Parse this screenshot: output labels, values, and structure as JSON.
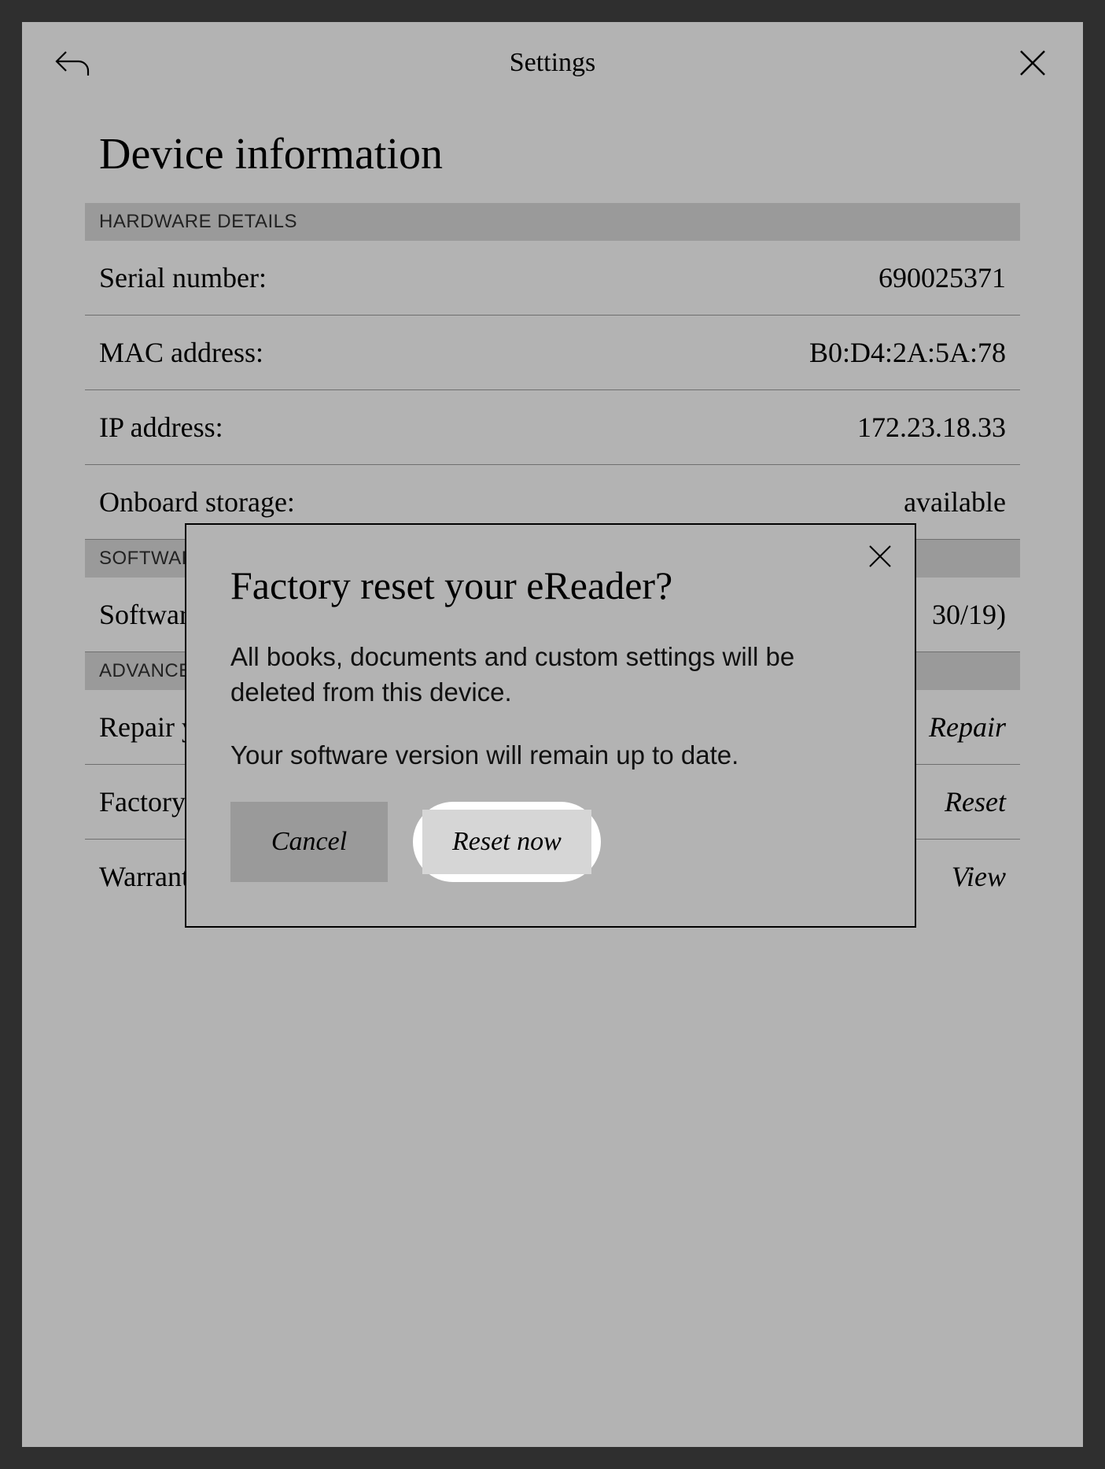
{
  "header": {
    "title": "Settings"
  },
  "page": {
    "title": "Device information"
  },
  "sections": {
    "hardware_header": "HARDWARE DETAILS",
    "software_header": "SOFTWARE DETAILS",
    "advanced_header": "ADVANCED"
  },
  "rows": {
    "serial_label": "Serial number:",
    "serial_value": "690025371",
    "mac_label": "MAC address:",
    "mac_value": "B0:D4:2A:5A:78",
    "ip_label": "IP address:",
    "ip_value": "172.23.18.33",
    "onboard_label": "Onboard storage:",
    "onboard_value": "available",
    "software_label": "Software version:",
    "software_value": "30/19)",
    "repair_label": "Repair your account:",
    "repair_action": "Repair",
    "factory_label": "Factory reset your eReader:",
    "factory_action": "Reset",
    "warranty_label": "Warranty & Legal:",
    "warranty_action": "View"
  },
  "modal": {
    "title": "Factory reset your eReader?",
    "body1": "All books, documents and custom settings will be deleted from this device.",
    "body2": "Your software version will remain up to date.",
    "cancel": "Cancel",
    "reset": "Reset now"
  }
}
